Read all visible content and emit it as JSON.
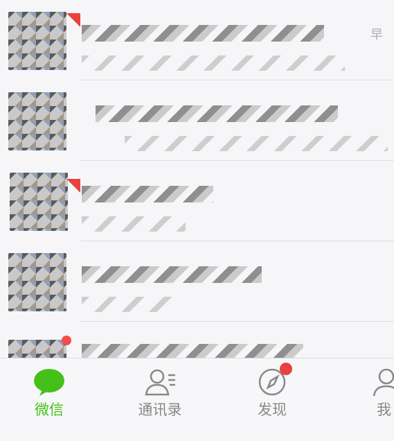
{
  "chats": [
    {
      "time": "早"
    },
    {
      "time": ""
    },
    {
      "time": ""
    },
    {
      "time": ""
    },
    {
      "time": ""
    }
  ],
  "tabs": [
    {
      "label": "微信",
      "icon": "chat-bubble-icon",
      "active": true
    },
    {
      "label": "通讯录",
      "icon": "contacts-icon",
      "active": false
    },
    {
      "label": "发现",
      "icon": "compass-icon",
      "active": false
    },
    {
      "label": "我",
      "icon": "profile-icon",
      "active": false
    }
  ],
  "colors": {
    "accent": "#45c01a",
    "badge": "#f24c4c",
    "inactive": "#888888"
  }
}
